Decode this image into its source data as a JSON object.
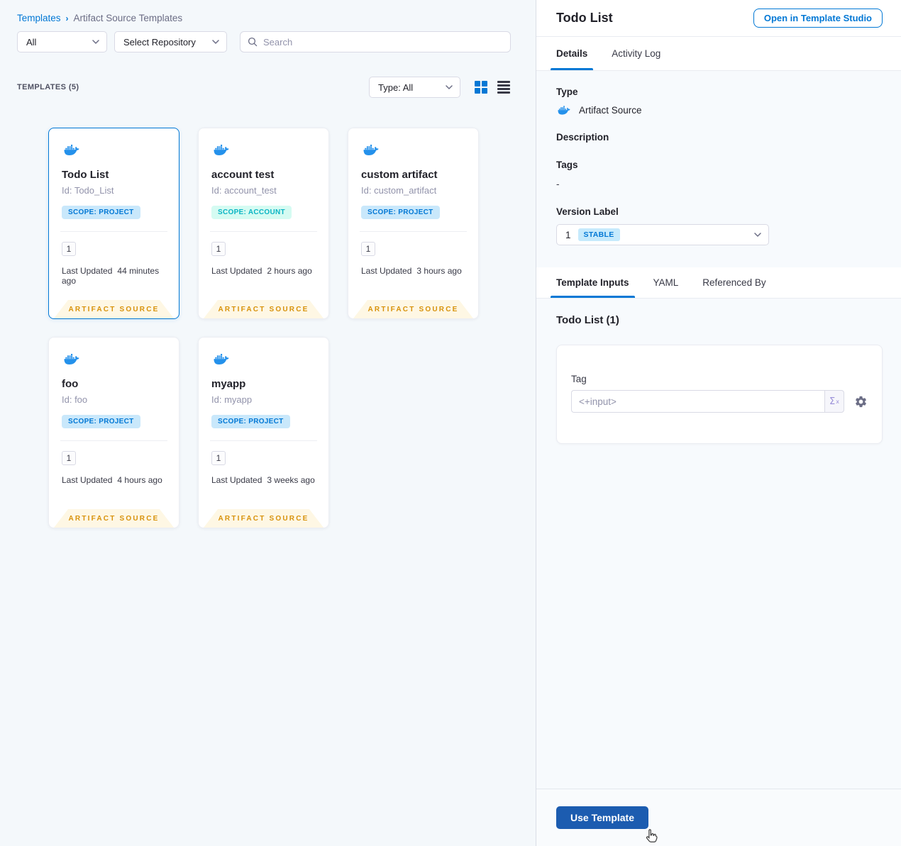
{
  "breadcrumb": {
    "root": "Templates",
    "current": "Artifact Source Templates"
  },
  "filters": {
    "scope_value": "All",
    "repository_value": "Select Repository",
    "search_placeholder": "Search"
  },
  "list_header": {
    "count_label": "TEMPLATES (5)",
    "type_filter_value": "Type: All"
  },
  "cards": [
    {
      "title": "Todo List",
      "id": "Id: Todo_List",
      "scope": "SCOPE: PROJECT",
      "scope_type": "project",
      "version_count": "1",
      "last_updated_label": "Last Updated",
      "last_updated": "44 minutes ago",
      "ribbon": "ARTIFACT SOURCE",
      "selected": true
    },
    {
      "title": "account test",
      "id": "Id: account_test",
      "scope": "SCOPE: ACCOUNT",
      "scope_type": "account",
      "version_count": "1",
      "last_updated_label": "Last Updated",
      "last_updated": "2 hours ago",
      "ribbon": "ARTIFACT SOURCE",
      "selected": false
    },
    {
      "title": "custom artifact",
      "id": "Id: custom_artifact",
      "scope": "SCOPE: PROJECT",
      "scope_type": "project",
      "version_count": "1",
      "last_updated_label": "Last Updated",
      "last_updated": "3 hours ago",
      "ribbon": "ARTIFACT SOURCE",
      "selected": false
    },
    {
      "title": "foo",
      "id": "Id: foo",
      "scope": "SCOPE: PROJECT",
      "scope_type": "project",
      "version_count": "1",
      "last_updated_label": "Last Updated",
      "last_updated": "4 hours ago",
      "ribbon": "ARTIFACT SOURCE",
      "selected": false
    },
    {
      "title": "myapp",
      "id": "Id: myapp",
      "scope": "SCOPE: PROJECT",
      "scope_type": "project",
      "version_count": "1",
      "last_updated_label": "Last Updated",
      "last_updated": "3 weeks ago",
      "ribbon": "ARTIFACT SOURCE",
      "selected": false
    }
  ],
  "panel": {
    "title": "Todo List",
    "open_studio_button": "Open in Template Studio",
    "tabs": [
      "Details",
      "Activity Log"
    ],
    "type_label": "Type",
    "type_value": "Artifact Source",
    "description_label": "Description",
    "tags_label": "Tags",
    "tags_value": "-",
    "version_label": "Version Label",
    "version_value": "1",
    "version_badge": "STABLE",
    "inputs_tabs": [
      "Template Inputs",
      "YAML",
      "Referenced By"
    ],
    "inputs_section_title": "Todo List (1)",
    "tag_label": "Tag",
    "tag_placeholder": "<+input>",
    "expression_button": "Σ",
    "expression_sup": "x",
    "use_template_button": "Use Template"
  },
  "colors": {
    "accent_blue": "#0278D5",
    "primary_button": "#1C5CB0",
    "ribbon_text": "#D8920B",
    "ribbon_bg": "#FEF7E4",
    "badge_project_bg": "#C9E8FB",
    "badge_account_bg": "#D5FBF2",
    "badge_account_text": "#0AB5C4"
  }
}
